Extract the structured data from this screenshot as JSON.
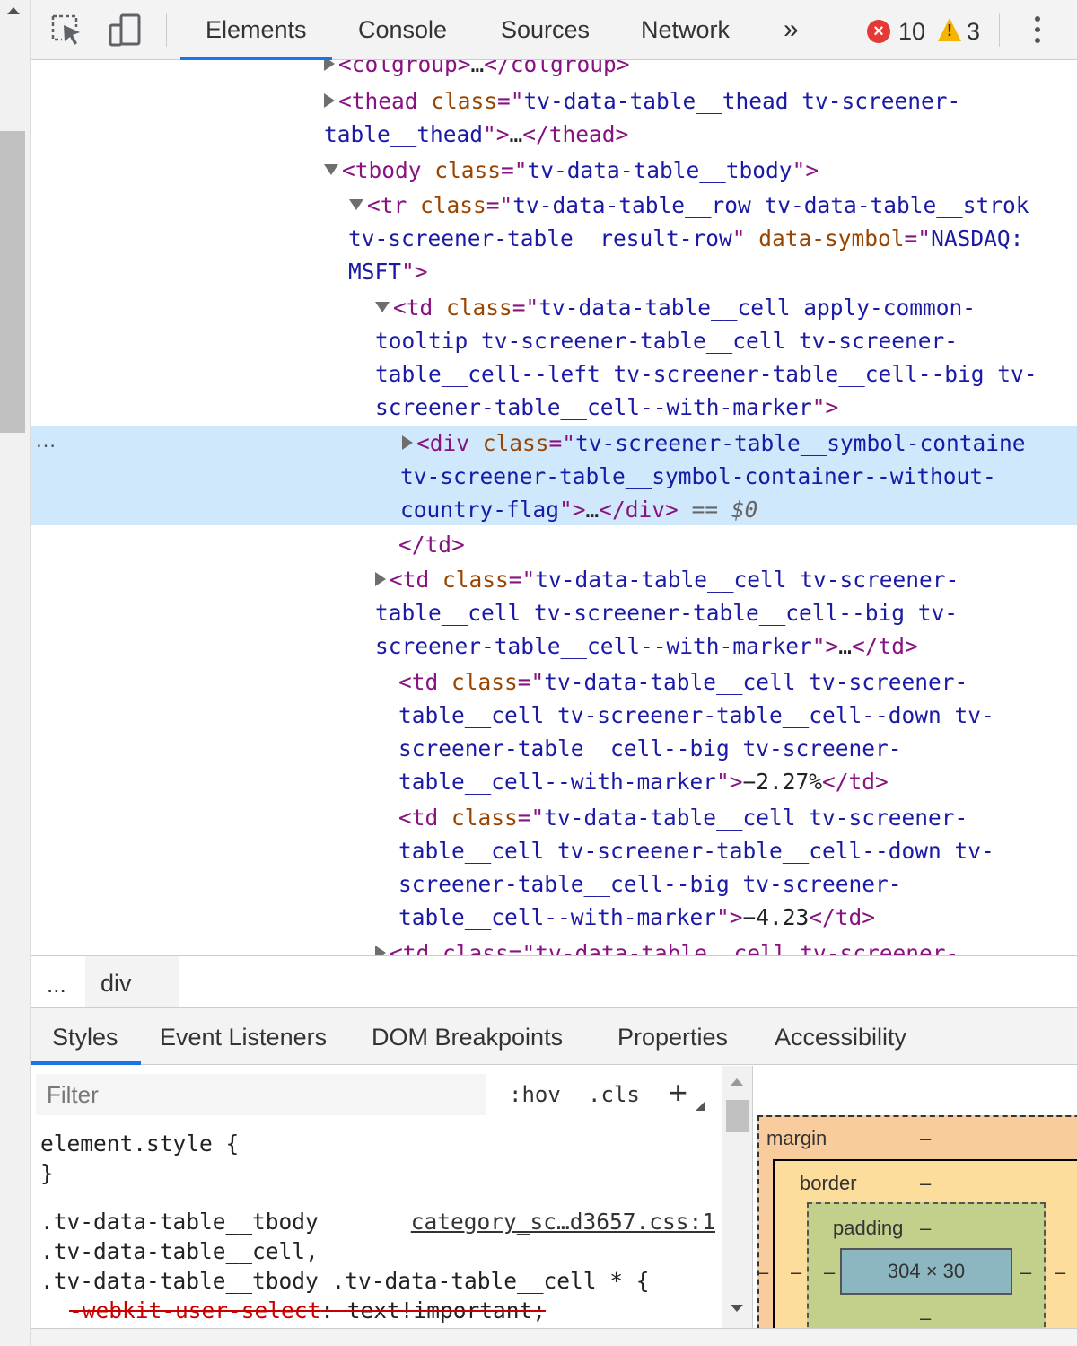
{
  "toolbar": {
    "tabs": [
      "Elements",
      "Console",
      "Sources",
      "Network"
    ],
    "more": "»",
    "error_count": "10",
    "warning_count": "3",
    "error_icon_glyph": "×",
    "warning_icon_glyph": "!"
  },
  "tree": {
    "l0_tag": "<colgroup>",
    "l0_ellipsis": "…",
    "l0_close": "</colgroup>",
    "l1_open": "<thead ",
    "l1_attr": "class",
    "l1_eq": "=\"",
    "l1_val": "tv-data-table__thead tv-screener-",
    "l1b_val": "table__thead",
    "l1b_q": "\">",
    "l1b_ell": "…",
    "l1b_close": "</thead>",
    "l2_open": "<tbody ",
    "l2_attr": "class",
    "l2_val": "tv-data-table__tbody",
    "l2_close": "\">",
    "l3_open": "<tr ",
    "l3_attr": "class",
    "l3_val": "tv-data-table__row tv-data-table__strok",
    "l3b_val": "tv-screener-table__result-row",
    "l3b_attr": "data-symbol",
    "l3b_val2": "NASDAQ:",
    "l3c_val": "MSFT",
    "l3c_close": "\">",
    "l4_open": "<td ",
    "l4_attr": "class",
    "l4_val": "tv-data-table__cell apply-common-",
    "l4b_val": "tooltip tv-screener-table__cell tv-screener-",
    "l4c_val": "table__cell--left tv-screener-table__cell--big tv-",
    "l4d_val": "screener-table__cell--with-marker",
    "l4d_close": "\">",
    "sel_gutter": "…",
    "l5_open": "<div ",
    "l5_attr": "class",
    "l5_val": "tv-screener-table__symbol-containe",
    "l5b_val": "tv-screener-table__symbol-container--without-",
    "l5c_val": "country-flag",
    "l5c_q": "\">",
    "l5c_ell": "…",
    "l5c_close": "</div>",
    "l5c_eq": " == $0",
    "l6_close": "</td>",
    "l7_open": "<td ",
    "l7_attr": "class",
    "l7_val": "tv-data-table__cell tv-screener-",
    "l7b_val": "table__cell tv-screener-table__cell--big tv-",
    "l7c_val": "screener-table__cell--with-marker",
    "l7c_q": "\">",
    "l7c_ell": "…",
    "l7c_close": "</td>",
    "l8_open": "<td ",
    "l8_attr": "class",
    "l8_val": "tv-data-table__cell tv-screener-",
    "l8b_val": "table__cell tv-screener-table__cell--down tv-",
    "l8c_val": "screener-table__cell--big tv-screener-",
    "l8d_val": "table__cell--with-marker",
    "l8d_q": "\">",
    "l8d_text": "−2.27%",
    "l8d_close": "</td>",
    "l9_open": "<td ",
    "l9_attr": "class",
    "l9_val": "tv-data-table__cell tv-screener-",
    "l9b_val": "table__cell tv-screener-table__cell--down tv-",
    "l9c_val": "screener-table__cell--big tv-screener-",
    "l9d_val": "table__cell--with-marker",
    "l9d_q": "\">",
    "l9d_text": "−4.23",
    "l9d_close": "</td>",
    "l10_text": "<td class=\"tv-data-table__cell tv-screener-"
  },
  "breadcrumb": {
    "dots": "...",
    "current": "div"
  },
  "subtabs": [
    "Styles",
    "Event Listeners",
    "DOM Breakpoints",
    "Properties",
    "Accessibility"
  ],
  "styles": {
    "filter_placeholder": "Filter",
    "hov": ":hov",
    "cls": ".cls",
    "plus": "+",
    "element_style_open": "element.style {",
    "element_style_close": "}",
    "rule_sel1": ".tv-data-table__tbody",
    "rule_source": "category_sc…d3657.css:1",
    "rule_sel2": ".tv-data-table__cell,",
    "rule_sel3": ".tv-data-table__tbody .tv-data-table__cell * {",
    "rule_prop": "-webkit-user-select",
    "rule_val": ": text!important;"
  },
  "boxmodel": {
    "margin_label": "margin",
    "margin_value": "–",
    "border_label": "border",
    "border_value": "–",
    "padding_label": "padding",
    "padding_value": "–",
    "content_size": "304 × 30",
    "dash": "–"
  }
}
